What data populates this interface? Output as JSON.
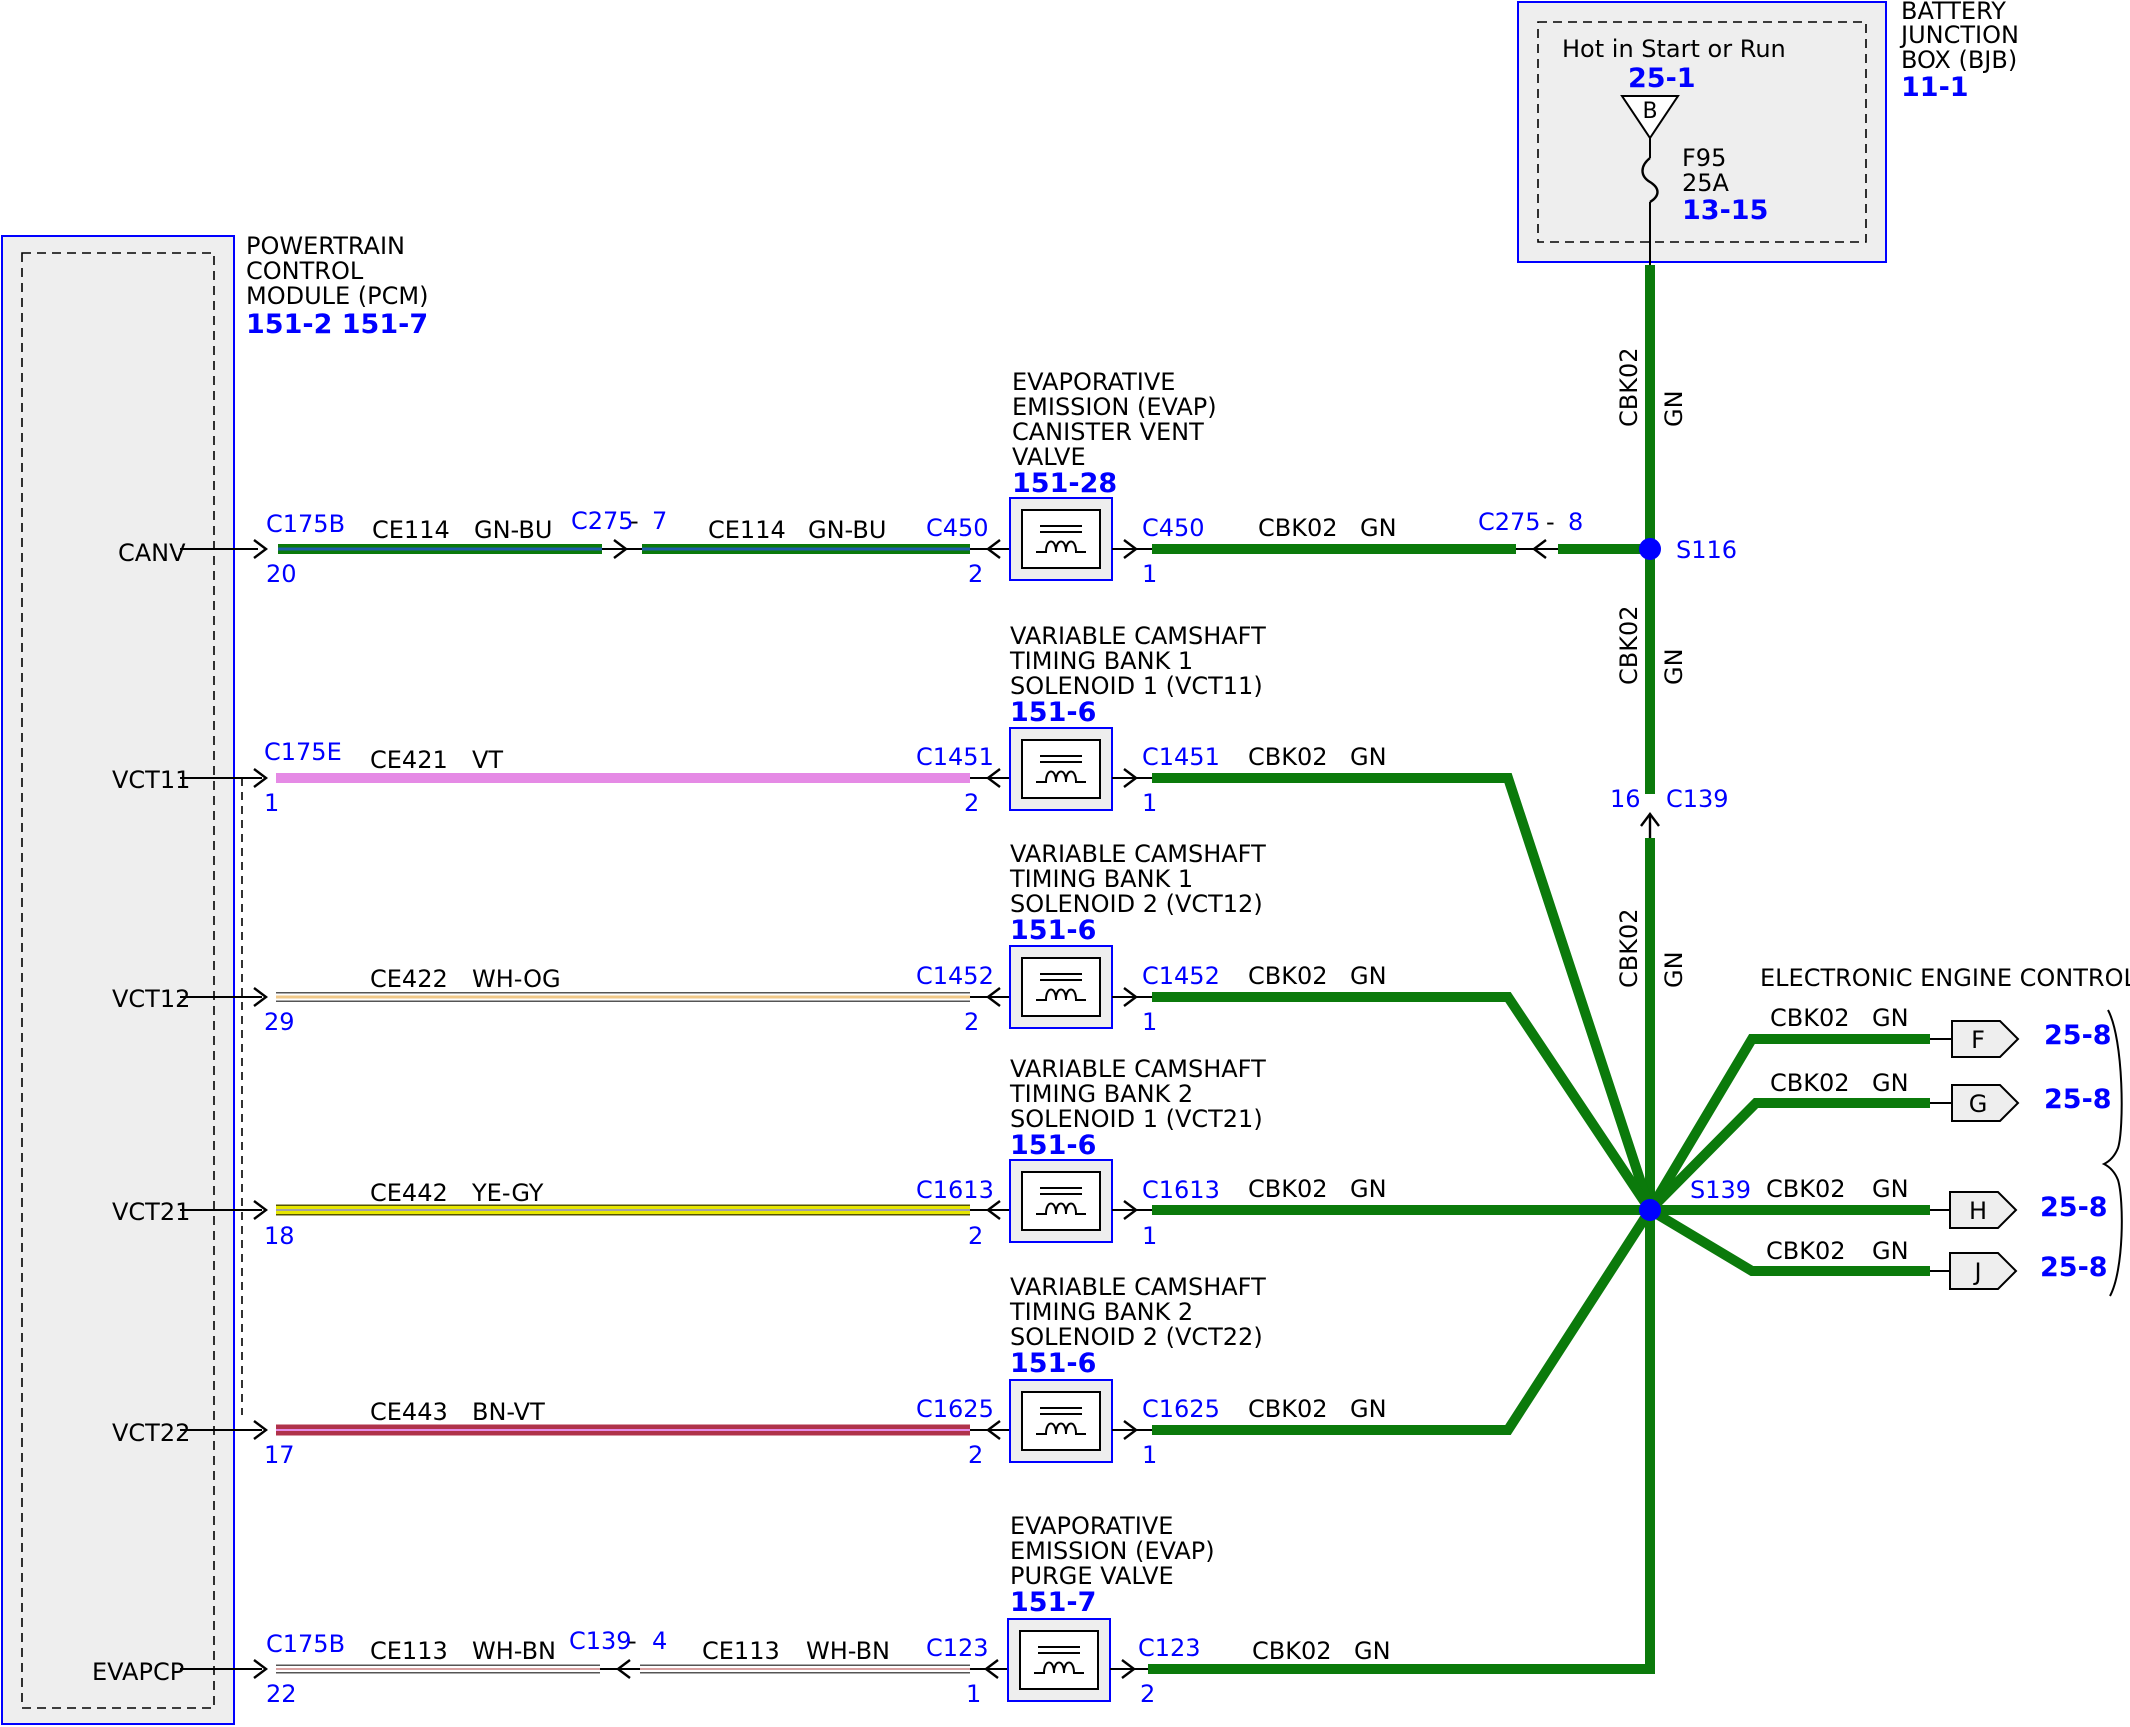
{
  "pcm": {
    "title_lines": [
      "POWERTRAIN",
      "CONTROL",
      "MODULE (PCM)"
    ],
    "refs": "151-2 151-7",
    "pins": [
      "CANV",
      "VCT11",
      "VCT12",
      "VCT21",
      "VCT22",
      "EVAPCP"
    ]
  },
  "bjb": {
    "title_lines": [
      "BATTERY",
      "JUNCTION",
      "BOX (BJB)"
    ],
    "ref": "11-1",
    "hot_label": "Hot in Start or Run",
    "hot_ref": "25-1",
    "bus_letter": "B",
    "fuse_name": "F95",
    "fuse_rating": "25A",
    "fuse_ref": "13-15"
  },
  "rows": [
    {
      "pin": "CANV",
      "pcm_conn": "C175B",
      "pcm_pin": "20",
      "circuit": "CE114",
      "color_code": "GN-BU",
      "inline_conn": "C275",
      "inline_pin": "7",
      "circuit2": "CE114",
      "color_code2": "GN-BU",
      "device_lines": [
        "EVAPORATIVE",
        "EMISSION (EVAP)",
        "CANISTER VENT",
        "VALVE"
      ],
      "device_ref": "151-28",
      "dev_conn_in": "C450",
      "dev_pin_in": "2",
      "dev_conn_out": "C450",
      "dev_pin_out": "1",
      "out_circuit": "CBK02",
      "out_color": "GN",
      "out_inline_conn": "C275",
      "out_inline_pin": "8"
    },
    {
      "pin": "VCT11",
      "pcm_conn": "C175E",
      "pcm_pin": "1",
      "circuit": "CE421",
      "color_code": "VT",
      "device_lines": [
        "VARIABLE CAMSHAFT",
        "TIMING BANK 1",
        "SOLENOID 1 (VCT11)"
      ],
      "device_ref": "151-6",
      "dev_conn_in": "C1451",
      "dev_pin_in": "2",
      "dev_conn_out": "C1451",
      "dev_pin_out": "1",
      "out_circuit": "CBK02",
      "out_color": "GN"
    },
    {
      "pin": "VCT12",
      "pcm_pin": "29",
      "circuit": "CE422",
      "color_code": "WH-OG",
      "device_lines": [
        "VARIABLE CAMSHAFT",
        "TIMING BANK 1",
        "SOLENOID 2 (VCT12)"
      ],
      "device_ref": "151-6",
      "dev_conn_in": "C1452",
      "dev_pin_in": "2",
      "dev_conn_out": "C1452",
      "dev_pin_out": "1",
      "out_circuit": "CBK02",
      "out_color": "GN"
    },
    {
      "pin": "VCT21",
      "pcm_pin": "18",
      "circuit": "CE442",
      "color_code": "YE-GY",
      "device_lines": [
        "VARIABLE CAMSHAFT",
        "TIMING BANK 2",
        "SOLENOID 1 (VCT21)"
      ],
      "device_ref": "151-6",
      "dev_conn_in": "C1613",
      "dev_pin_in": "2",
      "dev_conn_out": "C1613",
      "dev_pin_out": "1",
      "out_circuit": "CBK02",
      "out_color": "GN"
    },
    {
      "pin": "VCT22",
      "pcm_pin": "17",
      "circuit": "CE443",
      "color_code": "BN-VT",
      "device_lines": [
        "VARIABLE CAMSHAFT",
        "TIMING BANK 2",
        "SOLENOID 2 (VCT22)"
      ],
      "device_ref": "151-6",
      "dev_conn_in": "C1625",
      "dev_pin_in": "2",
      "dev_conn_out": "C1625",
      "dev_pin_out": "1",
      "out_circuit": "CBK02",
      "out_color": "GN"
    },
    {
      "pin": "EVAPCP",
      "pcm_conn": "C175B",
      "pcm_pin": "22",
      "circuit": "CE113",
      "color_code": "WH-BN",
      "inline_conn": "C139",
      "inline_pin": "4",
      "circuit2": "CE113",
      "color_code2": "WH-BN",
      "device_lines": [
        "EVAPORATIVE",
        "EMISSION (EVAP)",
        "PURGE VALVE"
      ],
      "device_ref": "151-7",
      "dev_conn_in": "C123",
      "dev_pin_in": "1",
      "dev_conn_out": "C123",
      "dev_pin_out": "2",
      "out_circuit": "CBK02",
      "out_color": "GN"
    }
  ],
  "vertical": {
    "circuit": "CBK02",
    "color": "GN",
    "splice_top": "S116",
    "splice_main": "S139",
    "inline_conn": "C139",
    "inline_pin": "16"
  },
  "eec": {
    "title": "ELECTRONIC ENGINE CONTROLS",
    "branches": [
      {
        "circuit": "CBK02",
        "color": "GN",
        "letter": "F",
        "ref": "25-8"
      },
      {
        "circuit": "CBK02",
        "color": "GN",
        "letter": "G",
        "ref": "25-8"
      },
      {
        "circuit": "CBK02",
        "color": "GN",
        "letter": "H",
        "ref": "25-8"
      },
      {
        "circuit": "CBK02",
        "color": "GN",
        "letter": "J",
        "ref": "25-8"
      }
    ]
  },
  "colors": {
    "link_blue": "#0000ff",
    "wire_green": "#0b7a0b",
    "wire_gn_bu": "#1e5fa8",
    "wire_vt": "#e58ae5",
    "wire_wh_og": "#f0c98a",
    "wire_ye_gy": "#e6e600",
    "wire_bn_vt": "#b0324a",
    "wire_wh_bn": "#d8c0c0"
  }
}
